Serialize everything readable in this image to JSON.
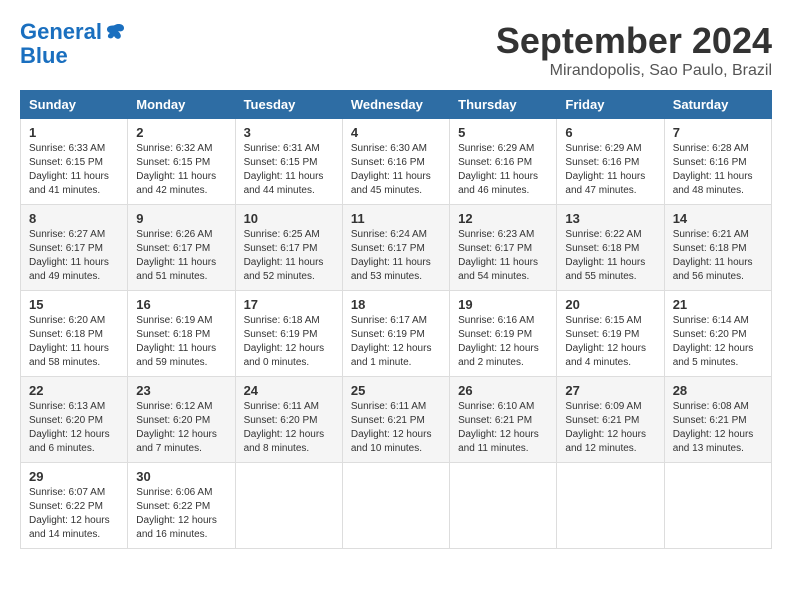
{
  "header": {
    "logo_line1": "General",
    "logo_line2": "Blue",
    "month_title": "September 2024",
    "location": "Mirandopolis, Sao Paulo, Brazil"
  },
  "weekdays": [
    "Sunday",
    "Monday",
    "Tuesday",
    "Wednesday",
    "Thursday",
    "Friday",
    "Saturday"
  ],
  "weeks": [
    [
      {
        "day": "1",
        "sunrise": "6:33 AM",
        "sunset": "6:15 PM",
        "daylight": "11 hours and 41 minutes."
      },
      {
        "day": "2",
        "sunrise": "6:32 AM",
        "sunset": "6:15 PM",
        "daylight": "11 hours and 42 minutes."
      },
      {
        "day": "3",
        "sunrise": "6:31 AM",
        "sunset": "6:15 PM",
        "daylight": "11 hours and 44 minutes."
      },
      {
        "day": "4",
        "sunrise": "6:30 AM",
        "sunset": "6:16 PM",
        "daylight": "11 hours and 45 minutes."
      },
      {
        "day": "5",
        "sunrise": "6:29 AM",
        "sunset": "6:16 PM",
        "daylight": "11 hours and 46 minutes."
      },
      {
        "day": "6",
        "sunrise": "6:29 AM",
        "sunset": "6:16 PM",
        "daylight": "11 hours and 47 minutes."
      },
      {
        "day": "7",
        "sunrise": "6:28 AM",
        "sunset": "6:16 PM",
        "daylight": "11 hours and 48 minutes."
      }
    ],
    [
      {
        "day": "8",
        "sunrise": "6:27 AM",
        "sunset": "6:17 PM",
        "daylight": "11 hours and 49 minutes."
      },
      {
        "day": "9",
        "sunrise": "6:26 AM",
        "sunset": "6:17 PM",
        "daylight": "11 hours and 51 minutes."
      },
      {
        "day": "10",
        "sunrise": "6:25 AM",
        "sunset": "6:17 PM",
        "daylight": "11 hours and 52 minutes."
      },
      {
        "day": "11",
        "sunrise": "6:24 AM",
        "sunset": "6:17 PM",
        "daylight": "11 hours and 53 minutes."
      },
      {
        "day": "12",
        "sunrise": "6:23 AM",
        "sunset": "6:17 PM",
        "daylight": "11 hours and 54 minutes."
      },
      {
        "day": "13",
        "sunrise": "6:22 AM",
        "sunset": "6:18 PM",
        "daylight": "11 hours and 55 minutes."
      },
      {
        "day": "14",
        "sunrise": "6:21 AM",
        "sunset": "6:18 PM",
        "daylight": "11 hours and 56 minutes."
      }
    ],
    [
      {
        "day": "15",
        "sunrise": "6:20 AM",
        "sunset": "6:18 PM",
        "daylight": "11 hours and 58 minutes."
      },
      {
        "day": "16",
        "sunrise": "6:19 AM",
        "sunset": "6:18 PM",
        "daylight": "11 hours and 59 minutes."
      },
      {
        "day": "17",
        "sunrise": "6:18 AM",
        "sunset": "6:19 PM",
        "daylight": "12 hours and 0 minutes."
      },
      {
        "day": "18",
        "sunrise": "6:17 AM",
        "sunset": "6:19 PM",
        "daylight": "12 hours and 1 minute."
      },
      {
        "day": "19",
        "sunrise": "6:16 AM",
        "sunset": "6:19 PM",
        "daylight": "12 hours and 2 minutes."
      },
      {
        "day": "20",
        "sunrise": "6:15 AM",
        "sunset": "6:19 PM",
        "daylight": "12 hours and 4 minutes."
      },
      {
        "day": "21",
        "sunrise": "6:14 AM",
        "sunset": "6:20 PM",
        "daylight": "12 hours and 5 minutes."
      }
    ],
    [
      {
        "day": "22",
        "sunrise": "6:13 AM",
        "sunset": "6:20 PM",
        "daylight": "12 hours and 6 minutes."
      },
      {
        "day": "23",
        "sunrise": "6:12 AM",
        "sunset": "6:20 PM",
        "daylight": "12 hours and 7 minutes."
      },
      {
        "day": "24",
        "sunrise": "6:11 AM",
        "sunset": "6:20 PM",
        "daylight": "12 hours and 8 minutes."
      },
      {
        "day": "25",
        "sunrise": "6:11 AM",
        "sunset": "6:21 PM",
        "daylight": "12 hours and 10 minutes."
      },
      {
        "day": "26",
        "sunrise": "6:10 AM",
        "sunset": "6:21 PM",
        "daylight": "12 hours and 11 minutes."
      },
      {
        "day": "27",
        "sunrise": "6:09 AM",
        "sunset": "6:21 PM",
        "daylight": "12 hours and 12 minutes."
      },
      {
        "day": "28",
        "sunrise": "6:08 AM",
        "sunset": "6:21 PM",
        "daylight": "12 hours and 13 minutes."
      }
    ],
    [
      {
        "day": "29",
        "sunrise": "6:07 AM",
        "sunset": "6:22 PM",
        "daylight": "12 hours and 14 minutes."
      },
      {
        "day": "30",
        "sunrise": "6:06 AM",
        "sunset": "6:22 PM",
        "daylight": "12 hours and 16 minutes."
      },
      null,
      null,
      null,
      null,
      null
    ]
  ]
}
